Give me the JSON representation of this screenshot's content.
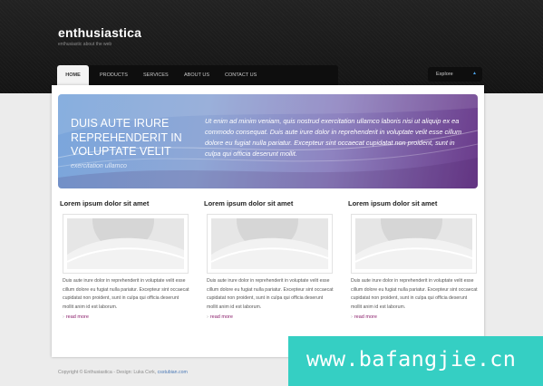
{
  "site": {
    "logo": "enthusiastica",
    "tagline": "enthusiastic about the web"
  },
  "nav": {
    "items": [
      "HOME",
      "PRODUCTS",
      "SERVICES",
      "ABOUT US",
      "CONTACT US"
    ],
    "active_index": 0
  },
  "explore": {
    "label": "Explore",
    "icon": "triangle-up-icon"
  },
  "banner": {
    "title": "DUIS AUTE IRURE REPREHENDERIT IN VOLUPTATE VELIT",
    "subtitle": "exercitation ullamco",
    "text": "Ut enim ad minim veniam, quis nostrud exercitation ullamco laboris nisi ut aliquip ex ea commodo consequat. Duis aute irure dolor in reprehenderit in voluptate velit esse cillum dolore eu fugiat nulla pariatur. Excepteur sint occaecat cupidatat non proident, sunt in culpa qui officia deserunt mollit."
  },
  "columns": [
    {
      "title": "Lorem ipsum dolor sit amet",
      "text": "Duis aute irure dolor in reprehenderit in voluptate velit esse cillum dolore eu fugiat nulla pariatur. Excepteur sint occaecat cupidatat non proident, sunt in culpa qui officia deserunt mollit anim id est laborum.",
      "link": "read more"
    },
    {
      "title": "Lorem ipsum dolor sit amet",
      "text": "Duis aute irure dolor in reprehenderit in voluptate velit esse cillum dolore eu fugiat nulla pariatur. Excepteur sint occaecat cupidatat non proident, sunt in culpa qui officia deserunt mollit anim id est laborum.",
      "link": "read more"
    },
    {
      "title": "Lorem ipsum dolor sit amet",
      "text": "Duis aute irure dolor in reprehenderit in voluptate velit esse cillum dolore eu fugiat nulla pariatur. Excepteur sint occaecat cupidatat non proident, sunt in culpa qui officia deserunt mollit anim id est laborum.",
      "link": "read more"
    }
  ],
  "footer": {
    "text": "Copyright © Enthusiastica - Design: Luka Cvrk,",
    "link": "csstubian.com"
  },
  "watermark": {
    "text": "www.bafangjie.cn"
  },
  "colors": {
    "header_bg": "#1b1b1b",
    "accent_link": "#8a1d6a",
    "watermark_bg": "#35cfc3"
  }
}
